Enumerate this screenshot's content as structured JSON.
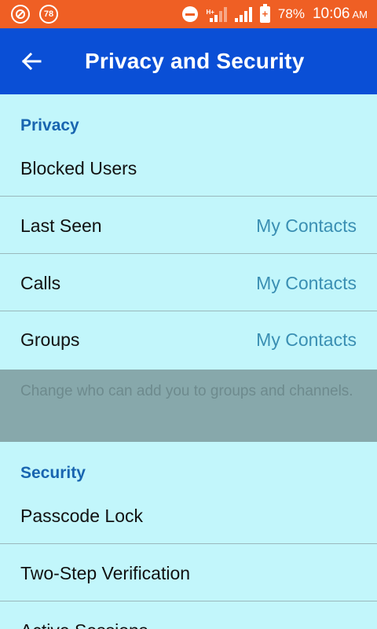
{
  "status_bar": {
    "notification_badge": "78",
    "battery_percent": "78%",
    "time": "10:06",
    "ampm": "AM",
    "network_type": "H+"
  },
  "app_bar": {
    "title": "Privacy and Security"
  },
  "privacy": {
    "header": "Privacy",
    "items": [
      {
        "label": "Blocked Users",
        "value": ""
      },
      {
        "label": "Last Seen",
        "value": "My Contacts"
      },
      {
        "label": "Calls",
        "value": "My Contacts"
      },
      {
        "label": "Groups",
        "value": "My Contacts"
      }
    ],
    "info": "Change who can add you to groups and channels."
  },
  "security": {
    "header": "Security",
    "items": [
      {
        "label": "Passcode Lock"
      },
      {
        "label": "Two-Step Verification"
      },
      {
        "label": "Active Sessions"
      }
    ]
  },
  "colors": {
    "status_bar": "#ef5f24",
    "app_bar": "#0a4fd6",
    "background": "#c2f6fb",
    "section_header": "#1865b0",
    "value_text": "#3a8fb3"
  }
}
